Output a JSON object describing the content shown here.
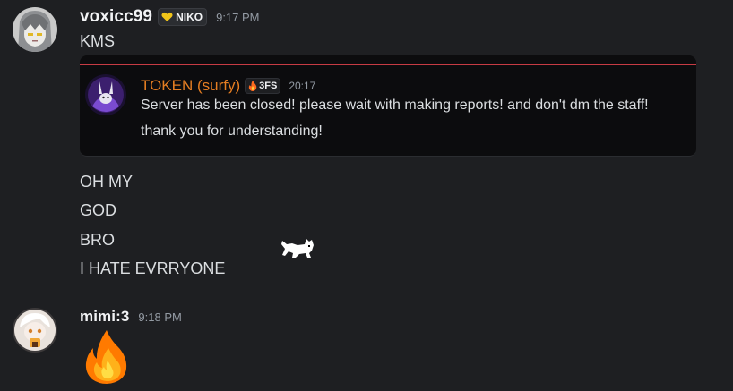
{
  "messages": [
    {
      "author": "voxicc99",
      "tag": "NIKO",
      "tag_icon": "heart-icon",
      "time": "9:17 PM",
      "lines": [
        "KMS"
      ],
      "embed": {
        "author": "TOKEN (surfy)",
        "tag": "3FS",
        "tag_icon": "fire-icon",
        "time": "20:17",
        "lines": [
          "Server has been closed! please wait with making reports! and don't dm the staff!",
          "thank you for understanding!"
        ],
        "accent_color": "#c73b44"
      },
      "after_lines": [
        "OH MY",
        "GOD",
        "BRO",
        "I HATE EVRRYONE"
      ]
    },
    {
      "author": "mimi:3",
      "time": "9:18 PM",
      "emoji": "fire-emoji"
    }
  ],
  "sticker": "white-cat-sticker"
}
